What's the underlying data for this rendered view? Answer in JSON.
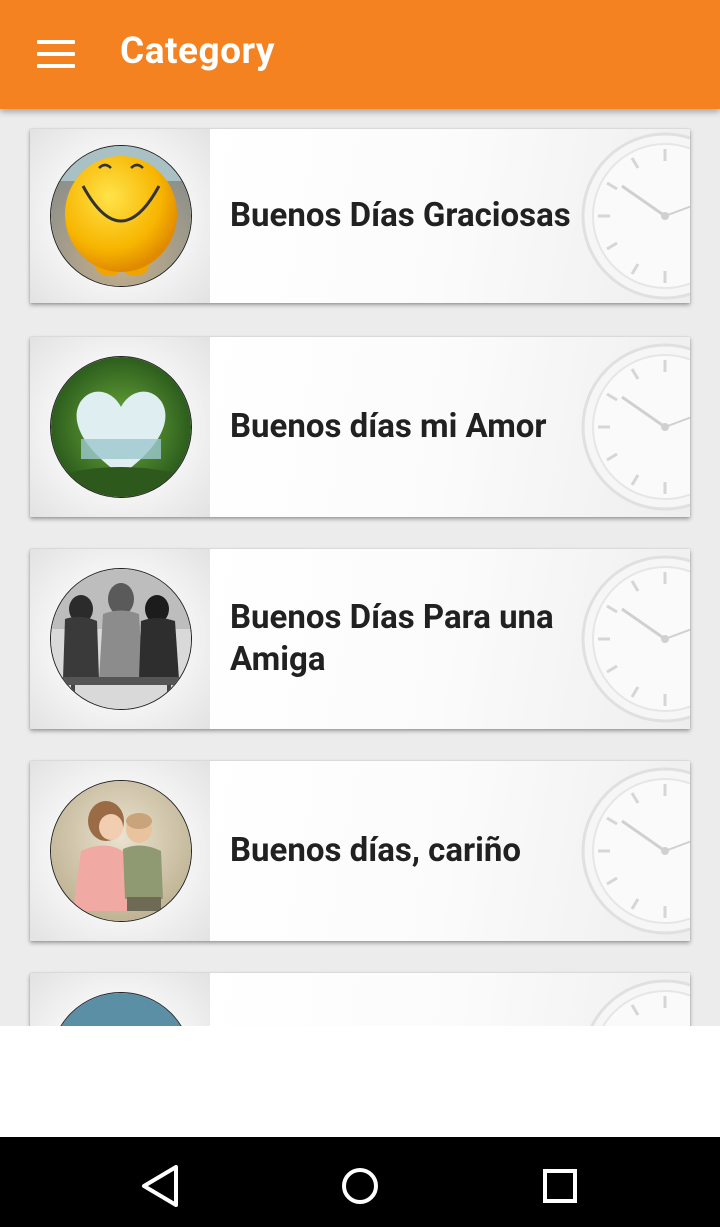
{
  "app_bar": {
    "title": "Category",
    "menu_icon": "hamburger-menu-icon",
    "color": "#f58220"
  },
  "categories": [
    {
      "label": "Buenos Días Graciosas",
      "image": "smiley-ball-image"
    },
    {
      "label": "Buenos días mi Amor",
      "image": "heart-leaves-image"
    },
    {
      "label": "Buenos Días Para una Amiga",
      "image": "friends-bench-image"
    },
    {
      "label": "Buenos días, cariño",
      "image": "kids-kiss-image"
    },
    {
      "label": "",
      "image": "blue-circle-image"
    }
  ],
  "nav_bar": {
    "back_icon": "back-triangle-icon",
    "home_icon": "home-circle-icon",
    "recents_icon": "recents-square-icon"
  }
}
